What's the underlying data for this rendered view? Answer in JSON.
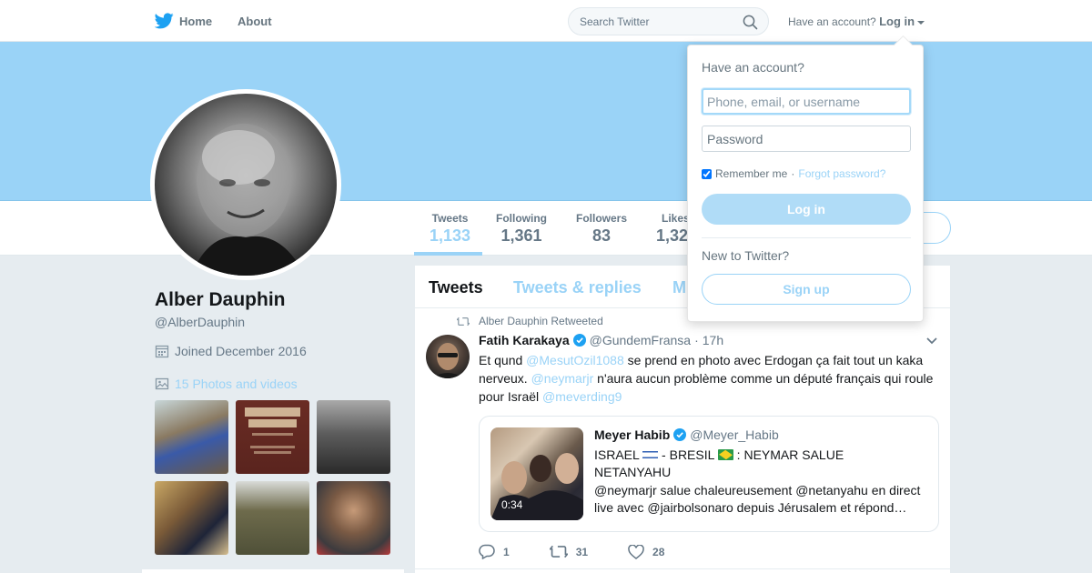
{
  "nav": {
    "home_label": "Home",
    "about_label": "About",
    "search_placeholder": "Search Twitter",
    "have_account_text": "Have an account?",
    "login_label": "Log in"
  },
  "profile": {
    "name": "Alber Dauphin",
    "screen_name": "@AlberDauphin",
    "joined": "Joined December 2016",
    "photos_label": "15 Photos and videos",
    "stats": [
      {
        "label": "Tweets",
        "value": "1,133"
      },
      {
        "label": "Following",
        "value": "1,361"
      },
      {
        "label": "Followers",
        "value": "83"
      },
      {
        "label": "Likes",
        "value": "1,32"
      }
    ]
  },
  "timeline": {
    "tabs": [
      "Tweets",
      "Tweets & replies",
      "M"
    ],
    "tweet": {
      "retweet_context": "Alber Dauphin Retweeted",
      "author_name": "Fatih Karakaya",
      "author_handle": "@GundemFransa",
      "separator": "·",
      "time": "17h",
      "text_parts": {
        "p1": "Et qund ",
        "m1": "@MesutOzil1088",
        "p2": " se prend en photo avec Erdogan ça fait tout un kaka nerveux. ",
        "m2": "@neymarjr",
        "p3": " n'aura aucun problème comme un député français qui roule pour Israël ",
        "m3": "@meverding9"
      },
      "quote": {
        "author_name": "Meyer Habib",
        "author_handle": "@Meyer_Habib",
        "video_time": "0:34",
        "title_a": "ISRAEL ",
        "title_b": " - BRESIL ",
        "title_c": " : NEYMAR SALUE NETANYAHU",
        "description": "@neymarjr salue chaleureusement @netanyahu en direct live avec @jairbolsonaro depuis Jérusalem et répond…"
      },
      "replies": "1",
      "retweets": "31",
      "likes": "28"
    }
  },
  "login_dropdown": {
    "title": "Have an account?",
    "username_placeholder": "Phone, email, or username",
    "password_placeholder": "Password",
    "remember_label": "Remember me",
    "dot": "·",
    "forgot_label": "Forgot password?",
    "login_button": "Log in",
    "new_text": "New to Twitter?",
    "signup_button": "Sign up"
  },
  "colors": {
    "accent": "#9ad3f7",
    "banner": "#9ad3f7",
    "background": "#e6ecf0",
    "verified": "#1da1f2"
  }
}
